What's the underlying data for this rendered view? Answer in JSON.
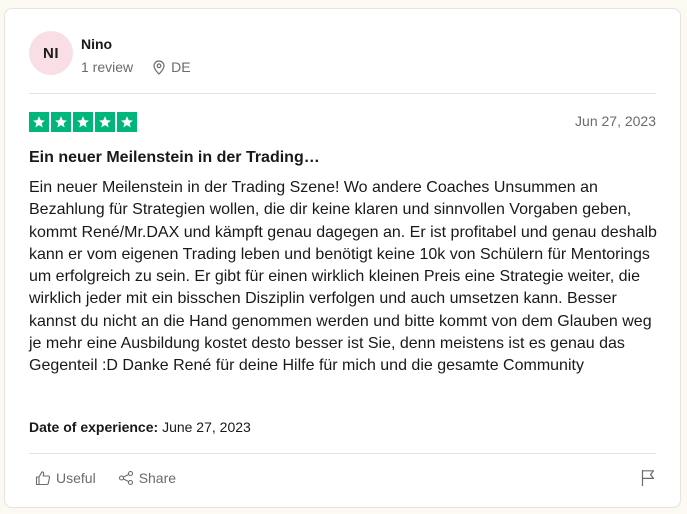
{
  "reviewer": {
    "initials": "NI",
    "name": "Nino",
    "review_count": "1 review",
    "country": "DE"
  },
  "review": {
    "rating": 5,
    "date": "Jun 27, 2023",
    "title": "Ein neuer Meilenstein in der Trading…",
    "body": "Ein neuer Meilenstein in der Trading Szene! Wo andere Coaches Unsummen an Bezahlung für Strategien wollen, die dir keine klaren und sinnvollen Vorgaben geben, kommt René/Mr.DAX und kämpft genau dagegen an. Er ist profitabel und genau deshalb kann er vom eigenen Trading leben und benötigt keine 10k von Schülern für Mentorings um erfolgreich zu sein. Er gibt für einen wirklich kleinen Preis eine Strategie weiter, die wirklich jeder mit ein bisschen Disziplin verfolgen und auch umsetzen kann. Besser kannst du nicht an die Hand genommen werden und bitte kommt von dem Glauben weg je mehr eine Ausbildung kostet desto besser ist Sie, denn meistens ist es genau das Gegenteil :D Danke René für deine Hilfe für mich und die gesamte Community",
    "experience_label": "Date of experience:",
    "experience_date": "June 27, 2023"
  },
  "actions": {
    "useful_label": "Useful",
    "share_label": "Share"
  },
  "icons": {
    "location": "location-pin-icon",
    "star": "star-icon",
    "useful": "thumbs-up-icon",
    "share": "share-icon",
    "flag": "flag-icon"
  },
  "colors": {
    "star_green": "#00b67a",
    "avatar_bg": "#f9dfe5",
    "muted_text": "#6b6b6b"
  }
}
